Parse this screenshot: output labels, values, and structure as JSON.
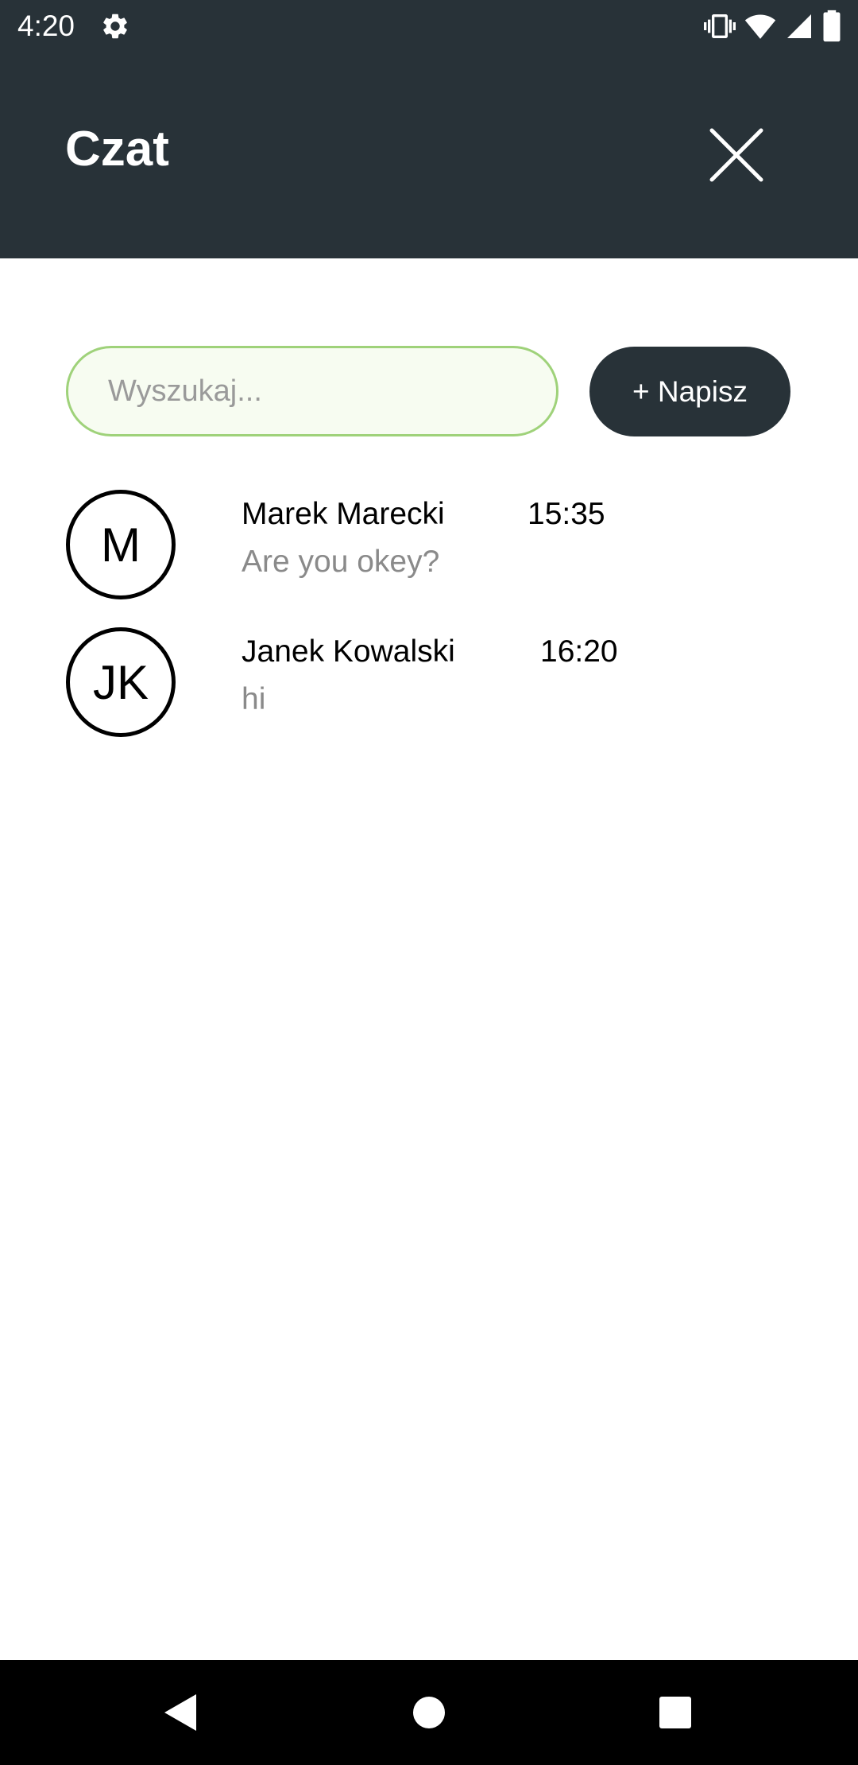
{
  "status_bar": {
    "time": "4:20",
    "icons": [
      "settings-icon",
      "vibrate-icon",
      "wifi-icon",
      "cell-signal-icon",
      "battery-icon"
    ]
  },
  "header": {
    "title": "Czat",
    "close_icon": "close-icon"
  },
  "search": {
    "placeholder": "Wyszukaj...",
    "value": ""
  },
  "new_message_button": {
    "label": "+ Napisz"
  },
  "conversations": [
    {
      "initials": "M",
      "name": "Marek Marecki",
      "time": "15:35",
      "preview": "Are you okey?"
    },
    {
      "initials": "JK",
      "name": "Janek Kowalski",
      "time": "16:20",
      "preview": "hi"
    }
  ],
  "nav_bar": {
    "buttons": [
      "back-icon",
      "home-icon",
      "recents-icon"
    ]
  },
  "colors": {
    "header_bg": "#283238",
    "search_border": "#9fd27a",
    "search_bg": "#f7fcf1",
    "preview_text": "#8a8a8a"
  }
}
